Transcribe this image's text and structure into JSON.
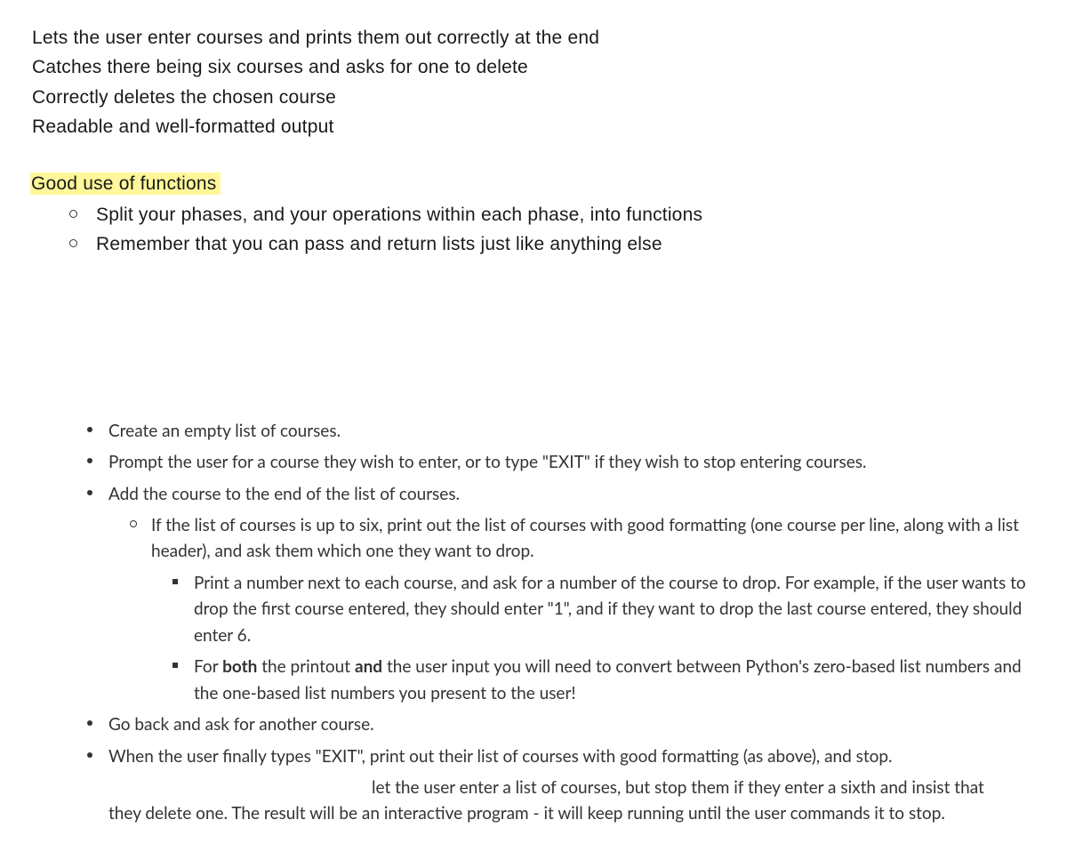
{
  "requirements": [
    "Lets the user enter courses and prints them out correctly at the end",
    "Catches there being six courses and asks for one to delete",
    "Correctly deletes the chosen course",
    "Readable and well-formatted output"
  ],
  "functions_heading": "Good use of functions",
  "functions_points": [
    "Split your phases, and your operations within each phase, into functions",
    "Remember that you can pass and return lists just like anything else"
  ],
  "steps": {
    "create_empty": "Create an empty list of courses.",
    "prompt_user": "Prompt the user for a course they wish to enter, or to type \"EXIT\" if they wish to stop entering courses.",
    "add_course": "Add the course to the end of the list of courses.",
    "six_check": "If the list of courses is up to six, print out the list of courses with good formatting (one course per line, along with a list header), and ask them which one they want to drop.",
    "print_number": "Print a number next to each course, and ask for a number of the course to drop.  For example, if the user wants to drop the first course entered, they should enter \"1\", and if they want to drop the last course entered, they should enter 6.",
    "both_prefix": "For ",
    "both_word": "both",
    "both_mid": " the printout ",
    "and_word": "and",
    "both_suffix": " the user input you will need to convert between Python's zero-based list numbers and the one-based list numbers you present to the user!",
    "go_back": "Go back and ask for another course.",
    "exit_final": "When the user finally types \"EXIT\", print out their list of courses with good formatting (as above), and stop."
  },
  "trailing": "let the user enter a list of courses, but stop them if they enter a sixth and insist that they delete one.  The result will be an interactive program - it will keep running until the user commands it to stop."
}
